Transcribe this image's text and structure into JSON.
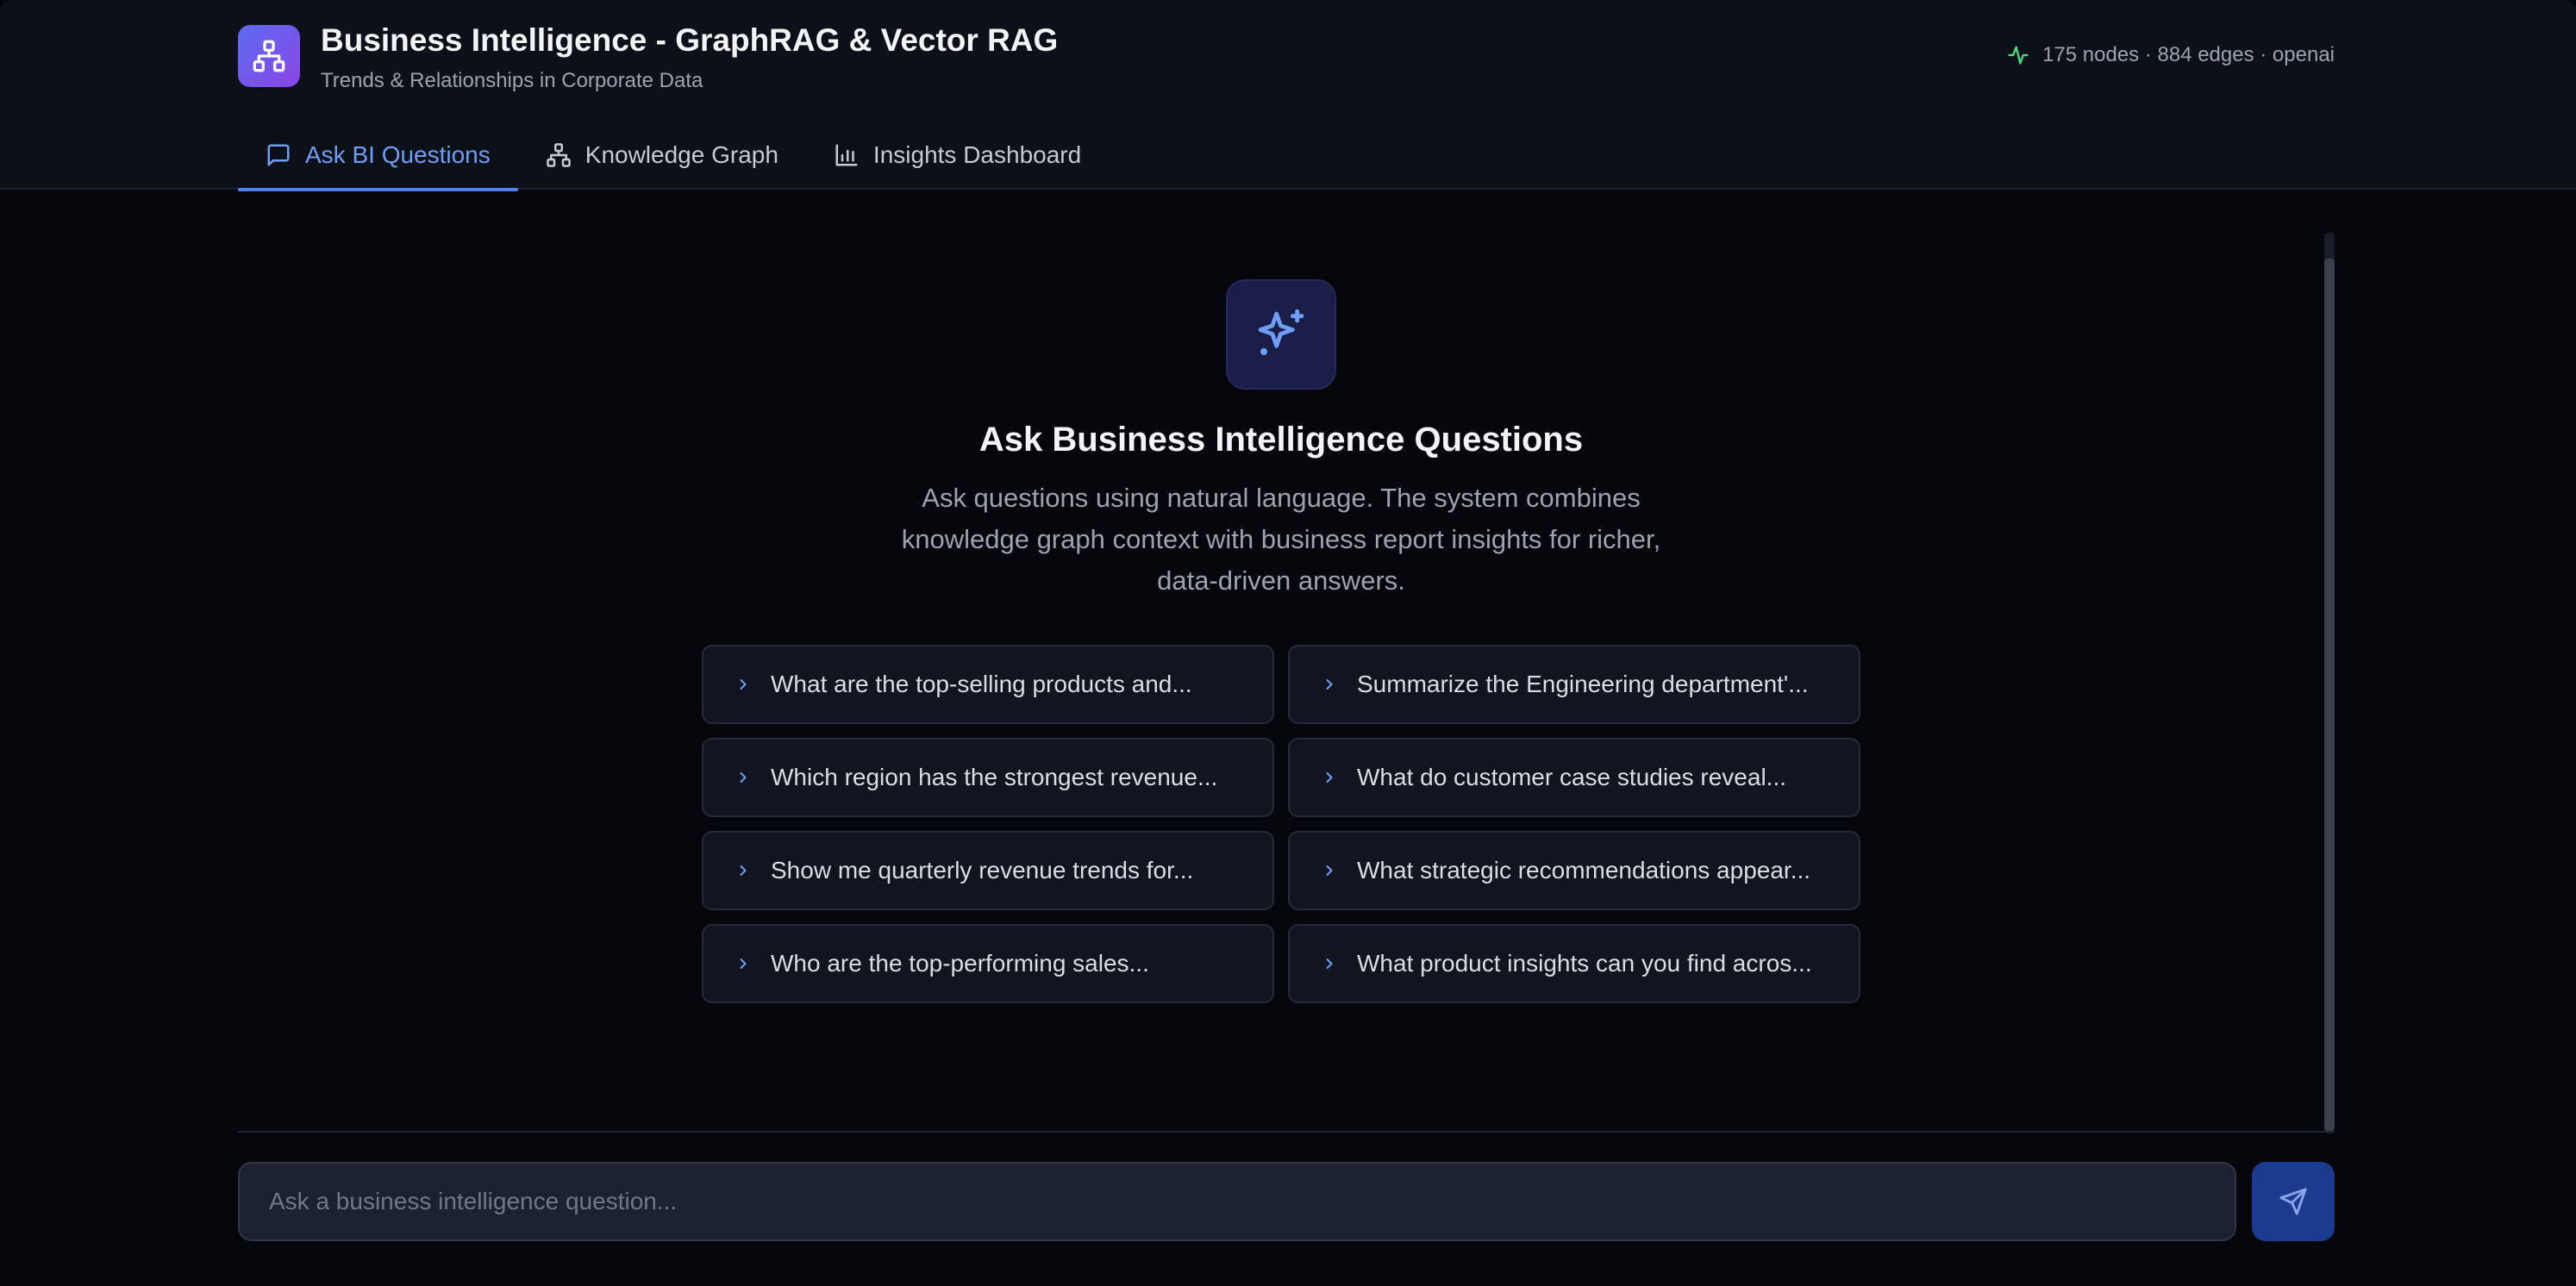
{
  "header": {
    "title": "Business Intelligence - GraphRAG & Vector RAG",
    "subtitle": "Trends & Relationships in Corporate Data",
    "status": "175 nodes · 884 edges · openai",
    "status_icon": "activity-icon"
  },
  "tabs": [
    {
      "label": "Ask BI Questions",
      "icon": "chat-icon",
      "active": true
    },
    {
      "label": "Knowledge Graph",
      "icon": "network-icon",
      "active": false
    },
    {
      "label": "Insights Dashboard",
      "icon": "bar-chart-icon",
      "active": false
    }
  ],
  "hero": {
    "icon": "sparkles-icon",
    "title": "Ask Business Intelligence Questions",
    "description": "Ask questions using natural language. The system combines knowledge graph context with business report insights for richer, data-driven answers."
  },
  "suggestions": [
    "What are the top-selling products and...",
    "Summarize the Engineering department'...",
    "Which region has the strongest revenue...",
    "What do customer case studies reveal...",
    "Show me quarterly revenue trends for...",
    "What strategic recommendations appear...",
    "Who are the top-performing sales...",
    "What product insights can you find acros..."
  ],
  "input": {
    "placeholder": "Ask a business intelligence question...",
    "value": ""
  },
  "colors": {
    "accent": "#6f9ef7",
    "status_ok": "#4ade80",
    "logo_gradient_start": "#5b6cf0",
    "logo_gradient_end": "#8b45e6",
    "send_button": "#1c3b8f"
  }
}
